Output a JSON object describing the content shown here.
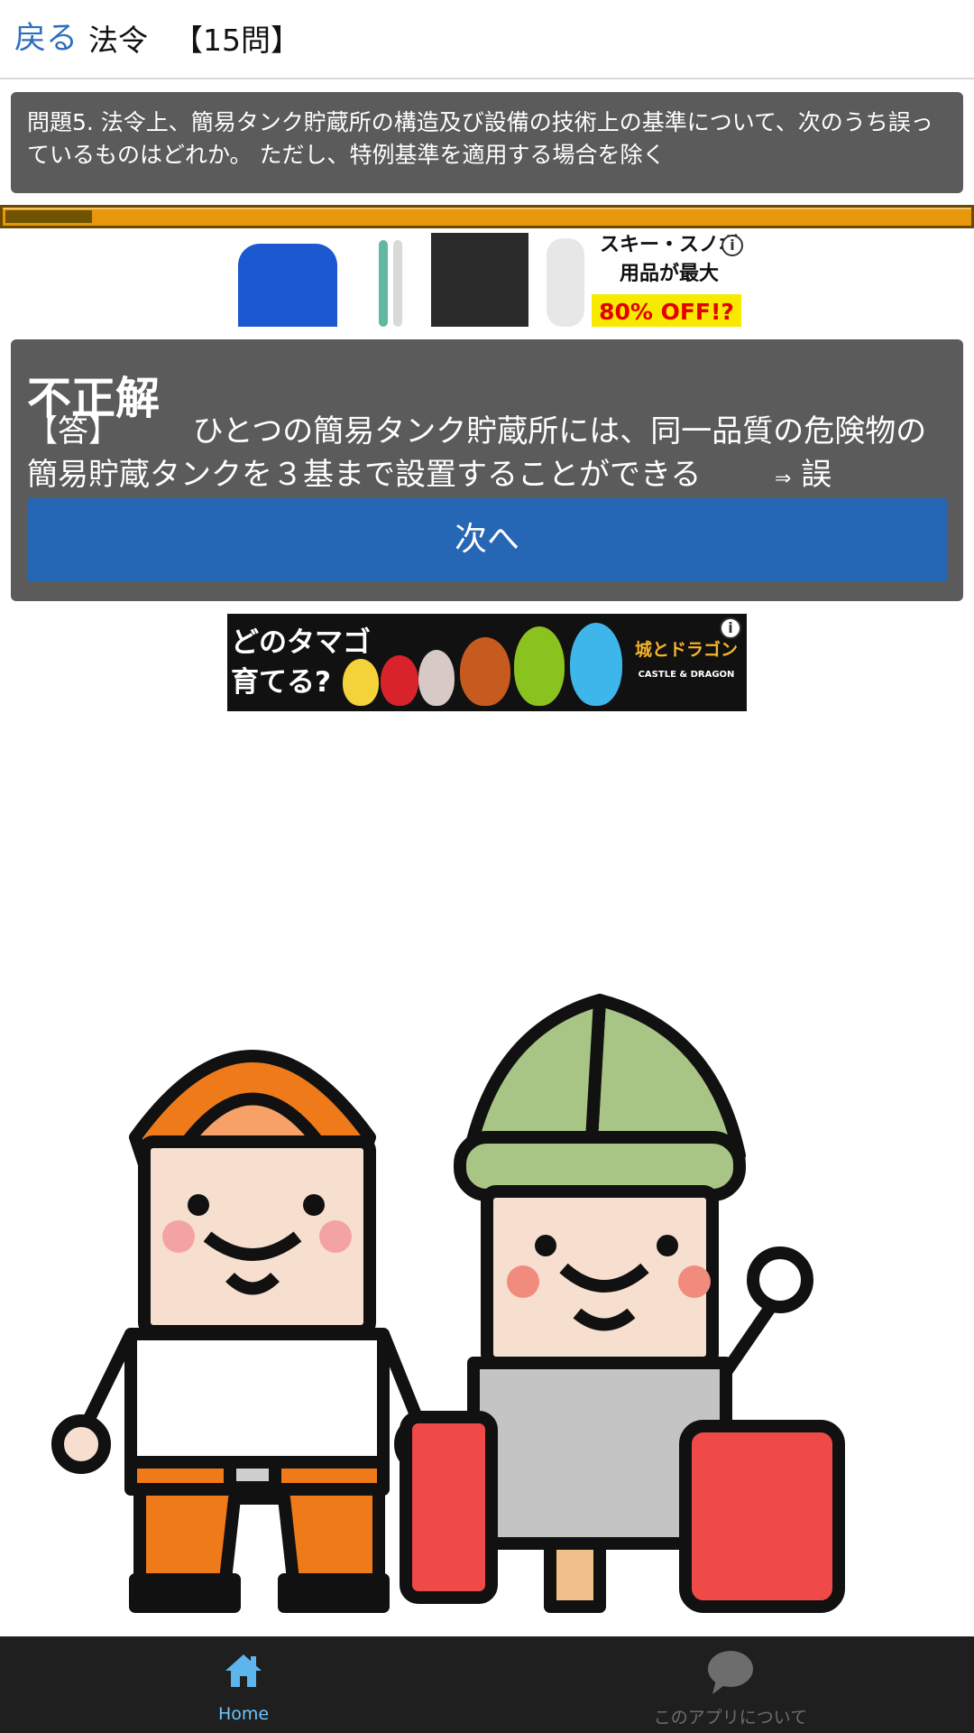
{
  "header": {
    "back_label": "戻る",
    "title": "法令",
    "count": "【15問】"
  },
  "question": {
    "text": "問題5. 法令上、簡易タンク貯蔵所の構造及び設備の技術上の基準について、次のうち誤っているものはどれか。 ただし、特例基準を適用する場合を除く"
  },
  "progress": {
    "fraction": 0.09
  },
  "ad_top": {
    "text_line1": "スキー・スノボ",
    "text_line2": "用品が最大",
    "sale": "80% OFF!?"
  },
  "result": {
    "title": "不正解",
    "answer_prefix": "【答】",
    "answer_text": "ひとつの簡易タンク貯蔵所には、同一品質の危険物の簡易貯蔵タンクを３基まで設置することができる",
    "answer_arrow": "⇒",
    "verdict": "誤",
    "next_label": "次へ"
  },
  "ad_bottom": {
    "line1": "どのタマゴ",
    "line2": "育てる?",
    "logo_main": "城とドラゴン",
    "logo_sub": "CASTLE & DRAGON"
  },
  "tabbar": {
    "home_label": "Home",
    "about_label": "このアプリについて",
    "home_icon": "home-icon",
    "about_icon": "speech-bubble-icon",
    "active_color": "#6cc6ff",
    "inactive_color": "#6d6d6d"
  },
  "colors": {
    "panel_bg": "#5a5b5a",
    "progress_bg": "#e8960c",
    "progress_fill": "#6f5300",
    "button_bg": "#2566b5",
    "link": "#2f6fbd"
  }
}
